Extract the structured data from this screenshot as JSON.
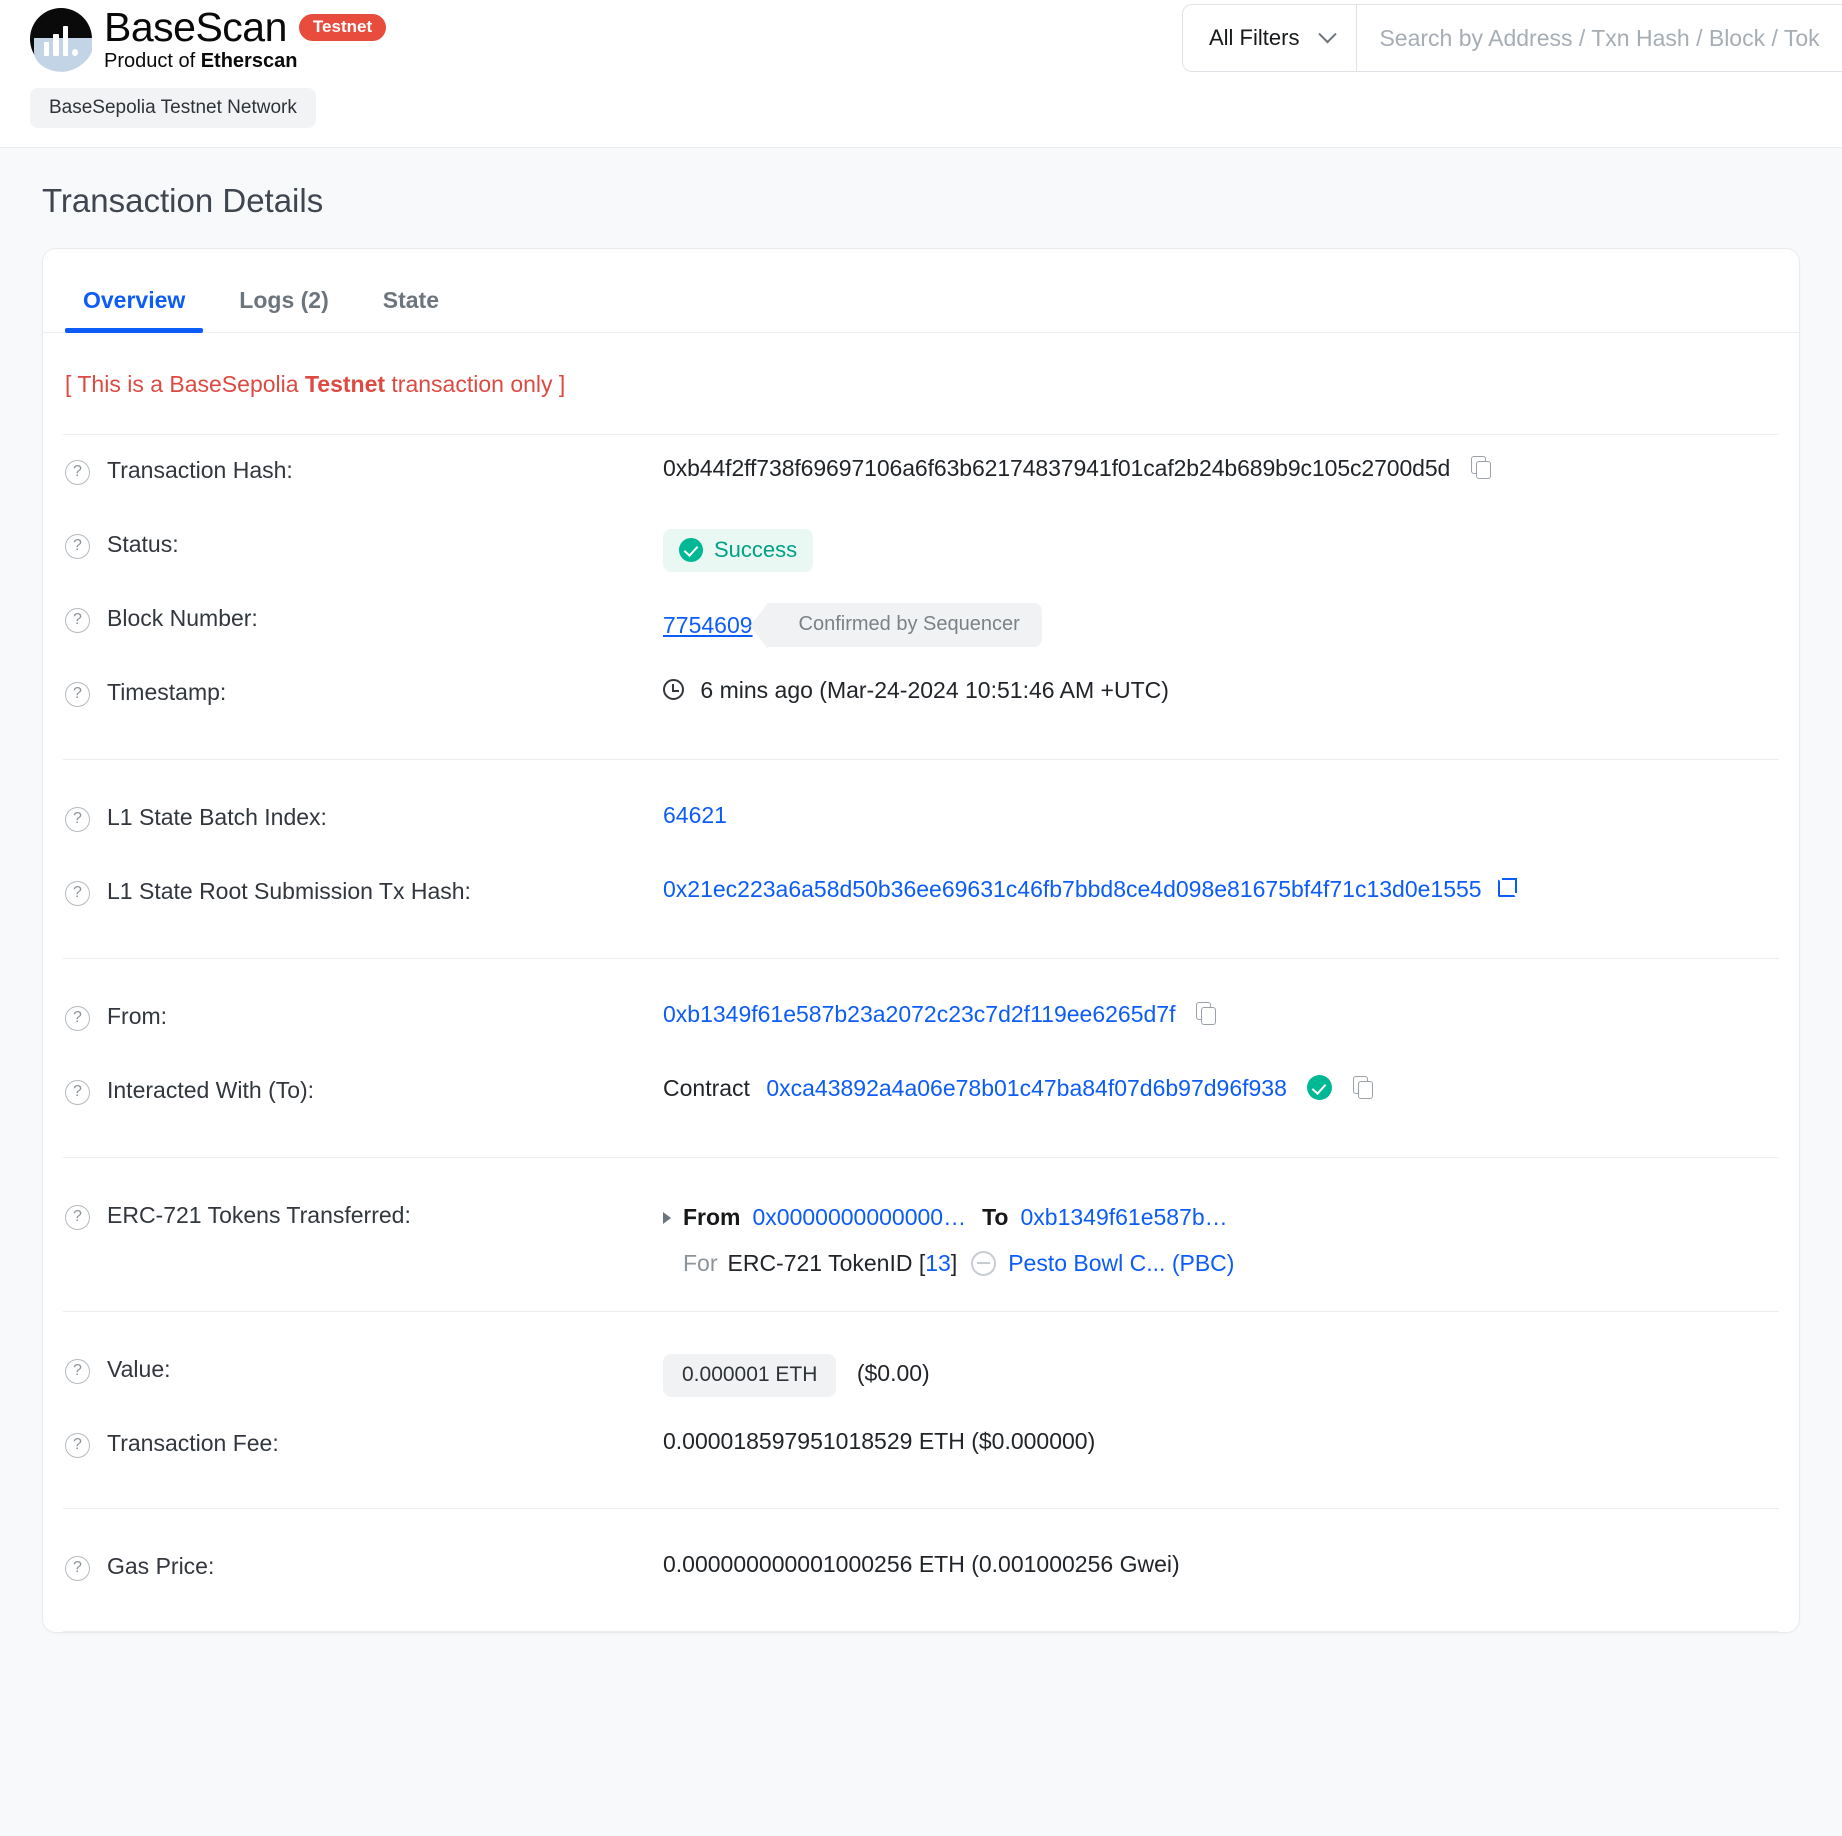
{
  "header": {
    "brand_name": "BaseScan",
    "brand_badge": "Testnet",
    "brand_sub_prefix": "Product of ",
    "brand_sub_strong": "Etherscan",
    "network_pill": "BaseSepolia Testnet Network",
    "filters_label": "All Filters",
    "search_placeholder": "Search by Address / Txn Hash / Block / Token / Domain Name"
  },
  "page": {
    "title": "Transaction Details"
  },
  "tabs": [
    {
      "label": "Overview",
      "active": true
    },
    {
      "label": "Logs (2)",
      "active": false
    },
    {
      "label": "State",
      "active": false
    }
  ],
  "notice": {
    "prefix": "[ This is a BaseSepolia ",
    "strong": "Testnet",
    "suffix": " transaction only ]"
  },
  "overview": {
    "transaction_hash_label": "Transaction Hash:",
    "transaction_hash": "0xb44f2ff738f69697106a6f63b62174837941f01caf2b24b689b9c105c2700d5d",
    "status_label": "Status:",
    "status_value": "Success",
    "block_number_label": "Block Number:",
    "block_number": "7754609",
    "block_confirmation": "Confirmed by Sequencer",
    "timestamp_label": "Timestamp:",
    "timestamp_value": "6 mins ago (Mar-24-2024 10:51:46 AM +UTC)",
    "l1_batch_label": "L1 State Batch Index:",
    "l1_batch_value": "64621",
    "l1_root_label": "L1 State Root Submission Tx Hash:",
    "l1_root_value": "0x21ec223a6a58d50b36ee69631c46fb7bbd8ce4d098e81675bf4f71c13d0e1555",
    "from_label": "From:",
    "from_value": "0xb1349f61e587b23a2072c23c7d2f119ee6265d7f",
    "to_label": "Interacted With (To):",
    "to_prefix": "Contract",
    "to_value": "0xca43892a4a06e78b01c47ba84f07d6b97d96f938",
    "erc721_label": "ERC-721 Tokens Transferred:",
    "erc721_from_word": "From",
    "erc721_from_addr": "0x0000000000000…",
    "erc721_to_word": "To",
    "erc721_to_addr": "0xb1349f61e587b…",
    "erc721_for_word": "For",
    "erc721_token_standard": "ERC-721 TokenID [",
    "erc721_token_id": "13",
    "erc721_token_id_close": "]",
    "erc721_token_name": "Pesto Bowl C... (PBC)",
    "value_label": "Value:",
    "value_eth": "0.000001 ETH",
    "value_usd": "($0.00)",
    "fee_label": "Transaction Fee:",
    "fee_value": "0.000018597951018529 ETH ($0.000000)",
    "gas_price_label": "Gas Price:",
    "gas_price_value": "0.000000000001000256 ETH (0.001000256 Gwei)"
  },
  "colors": {
    "accent_link": "#0c5cf7",
    "success": "#00b894",
    "testnet_red": "#e74c3c",
    "notice_red": "#dc4a42"
  }
}
